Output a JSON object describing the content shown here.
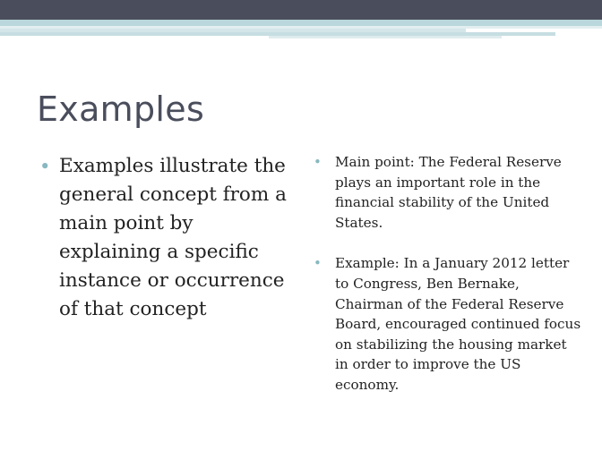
{
  "slide": {
    "title": "Examples",
    "left_bullet": "Examples illustrate the general concept from a main point by explaining a specific instance or occurrence of that concept",
    "right_bullets": [
      "Main point: The Federal Reserve plays an important role in the financial stability of the United States.",
      "Example: In a January 2012 letter to Congress, Ben Bernake, Chairman of the Federal Reserve Board, encouraged continued focus on stabilizing the housing market in order to improve the US economy."
    ],
    "bullet_glyph": "•"
  },
  "colors": {
    "header_band": "#4a4e5c",
    "accent_stripe": "#b9d7dc",
    "title_text": "#4a4e5c",
    "bullet": "#88b8c0",
    "body_text": "#222222"
  }
}
